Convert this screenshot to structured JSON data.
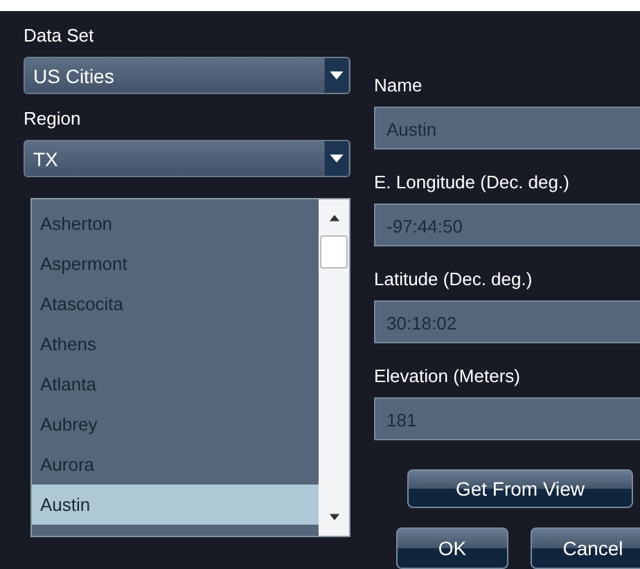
{
  "data_set": {
    "label": "Data Set",
    "value": "US Cities"
  },
  "region": {
    "label": "Region",
    "value": "TX"
  },
  "cities": [
    {
      "name": "Asherton",
      "selected": false
    },
    {
      "name": "Aspermont",
      "selected": false
    },
    {
      "name": "Atascocita",
      "selected": false
    },
    {
      "name": "Athens",
      "selected": false
    },
    {
      "name": "Atlanta",
      "selected": false
    },
    {
      "name": "Aubrey",
      "selected": false
    },
    {
      "name": "Aurora",
      "selected": false
    },
    {
      "name": "Austin",
      "selected": true
    }
  ],
  "fields": [
    {
      "label": "Name",
      "value": "Austin"
    },
    {
      "label": "E. Longitude (Dec. deg.)",
      "value": "-97:44:50"
    },
    {
      "label": "Latitude (Dec. deg.)",
      "value": "30:18:02"
    },
    {
      "label": "Elevation (Meters)",
      "value": "181"
    }
  ],
  "get_from_view": "Get From View",
  "buttons": [
    "OK",
    "Cancel"
  ]
}
